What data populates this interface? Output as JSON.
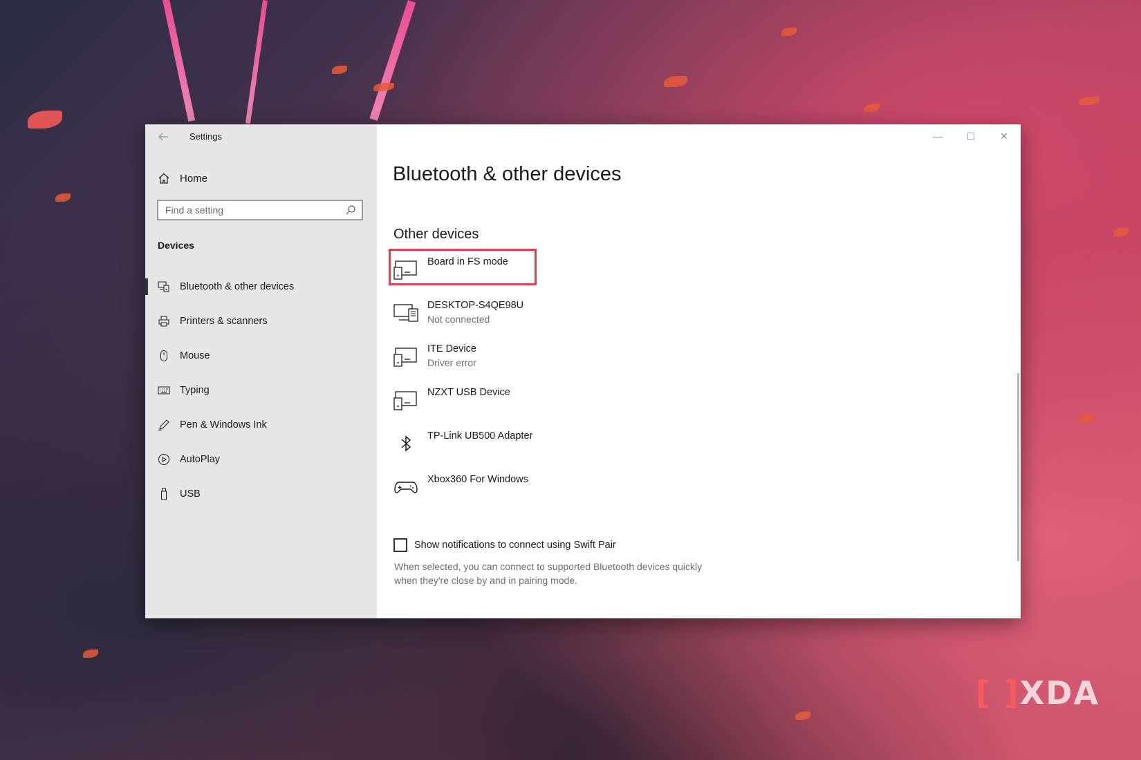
{
  "window": {
    "title": "Settings",
    "controls": {
      "minimize": "—",
      "maximize": "☐",
      "close": "✕"
    }
  },
  "sidebar": {
    "home_label": "Home",
    "search_placeholder": "Find a setting",
    "section_label": "Devices",
    "items": [
      {
        "label": "Bluetooth & other devices",
        "icon": "bluetooth-devices-icon",
        "selected": true
      },
      {
        "label": "Printers & scanners",
        "icon": "printer-icon",
        "selected": false
      },
      {
        "label": "Mouse",
        "icon": "mouse-icon",
        "selected": false
      },
      {
        "label": "Typing",
        "icon": "keyboard-icon",
        "selected": false
      },
      {
        "label": "Pen & Windows Ink",
        "icon": "pen-icon",
        "selected": false
      },
      {
        "label": "AutoPlay",
        "icon": "autoplay-icon",
        "selected": false
      },
      {
        "label": "USB",
        "icon": "usb-icon",
        "selected": false
      }
    ]
  },
  "main": {
    "title": "Bluetooth & other devices",
    "section_title": "Other devices",
    "devices": [
      {
        "name": "Board in FS mode",
        "status": "",
        "icon": "device-icon",
        "highlighted": true
      },
      {
        "name": "DESKTOP-S4QE98U",
        "status": "Not connected",
        "icon": "computer-icon"
      },
      {
        "name": "ITE Device",
        "status": "Driver error",
        "icon": "device-icon"
      },
      {
        "name": "NZXT USB Device",
        "status": "",
        "icon": "device-icon"
      },
      {
        "name": "TP-Link UB500 Adapter",
        "status": "",
        "icon": "bluetooth-icon"
      },
      {
        "name": "Xbox360 For Windows",
        "status": "",
        "icon": "gamepad-icon"
      }
    ],
    "swift_pair": {
      "label": "Show notifications to connect using Swift Pair",
      "checked": false,
      "description": "When selected, you can connect to supported Bluetooth devices quickly when they're close by and in pairing mode."
    }
  },
  "watermark": {
    "text": "XDA",
    "bracket": "[ ]"
  },
  "colors": {
    "highlight_border": "#e0414f",
    "sidebar_bg": "#e6e6e6",
    "window_bg": "#ffffff"
  }
}
